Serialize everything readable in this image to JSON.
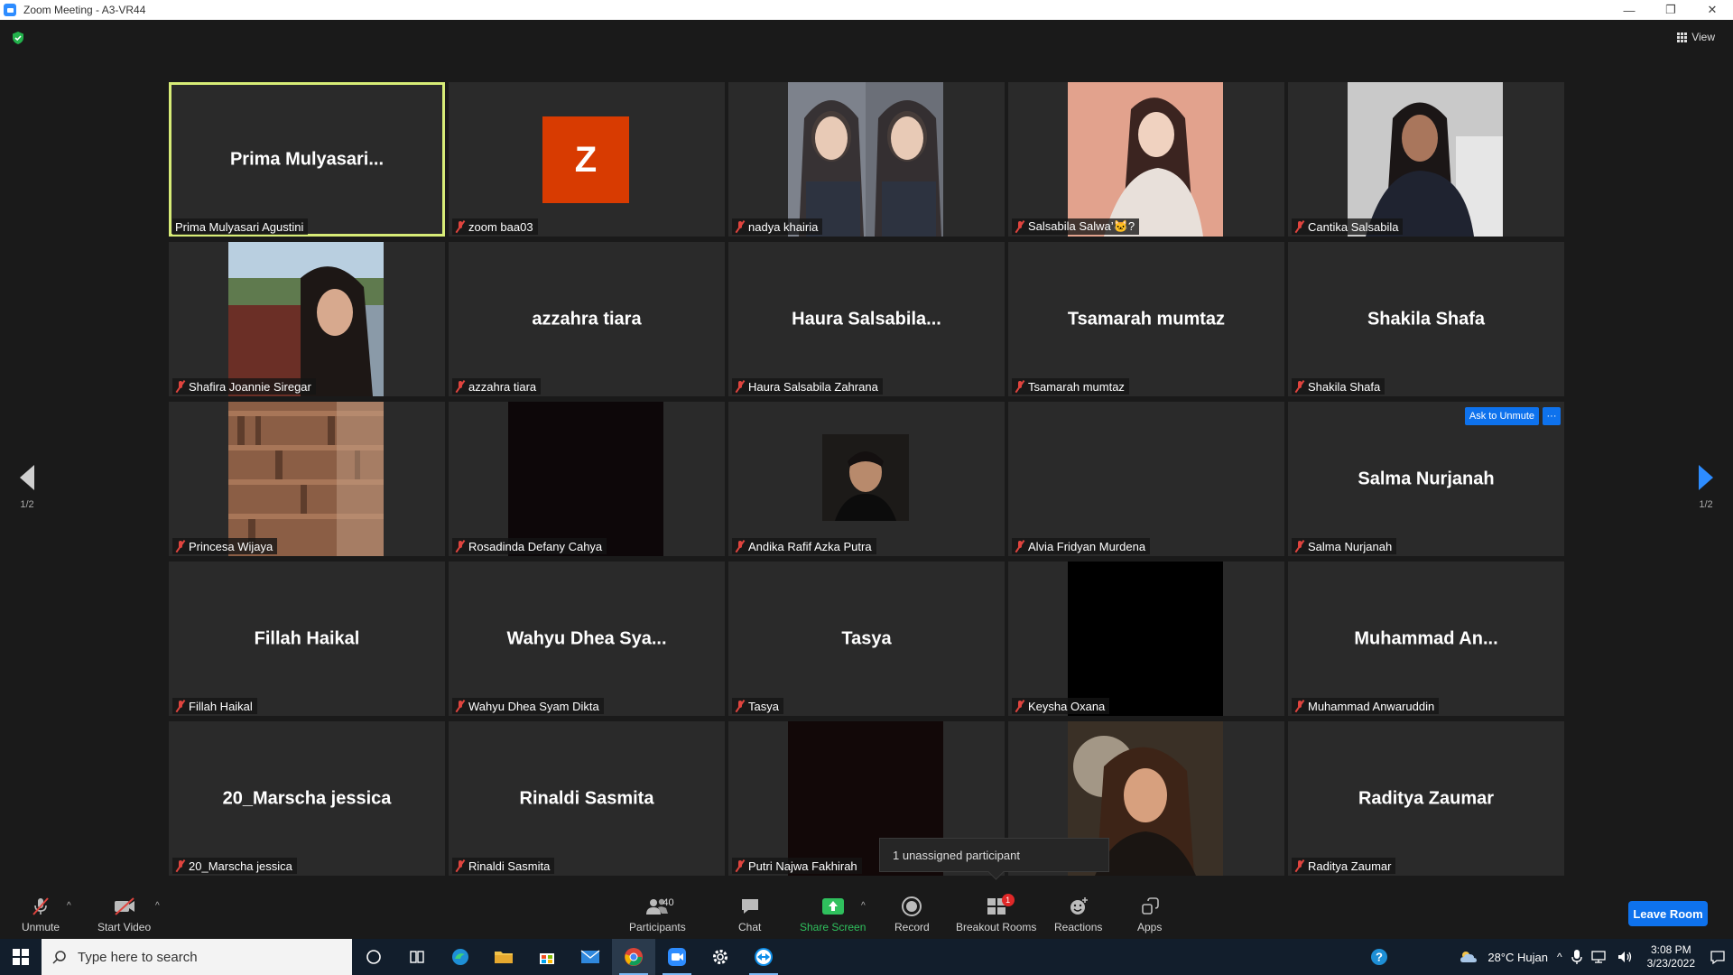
{
  "window": {
    "title": "Zoom Meeting - A3-VR44",
    "minimize": "—",
    "restore": "❐",
    "close": "✕"
  },
  "view_button": "View",
  "pager": {
    "left": "1/2",
    "right": "1/2"
  },
  "tiles": [
    {
      "big": "Prima  Mulyasari...",
      "label": "Prima Mulyasari Agustini",
      "muted": false,
      "active": true
    },
    {
      "big": "",
      "label": "zoom baa03",
      "muted": true,
      "avatar_letter": "Z"
    },
    {
      "big": "",
      "label": "nadya khairia",
      "muted": true
    },
    {
      "big": "",
      "label": "Salsabila Salwa’🐱?",
      "muted": true
    },
    {
      "big": "",
      "label": "Cantika Salsabila",
      "muted": true
    },
    {
      "big": "",
      "label": "Shafira Joannie Siregar",
      "muted": true
    },
    {
      "big": "azzahra tiara",
      "label": "azzahra tiara",
      "muted": true
    },
    {
      "big": "Haura  Salsabila...",
      "label": "Haura Salsabila Zahrana",
      "muted": true
    },
    {
      "big": "Tsamarah mumtaz",
      "label": "Tsamarah mumtaz",
      "muted": true
    },
    {
      "big": "Shakila Shafa",
      "label": "Shakila Shafa",
      "muted": true
    },
    {
      "big": "",
      "label": "Princesa Wijaya",
      "muted": true
    },
    {
      "big": "",
      "label": "Rosadinda Defany Cahya",
      "muted": true
    },
    {
      "big": "",
      "label": "Andika Rafif Azka Putra",
      "muted": true
    },
    {
      "big": "",
      "label": "Alvia Fridyan Murdena",
      "muted": true
    },
    {
      "big": "Salma Nurjanah",
      "label": "Salma Nurjanah",
      "muted": true,
      "ask_unmute": "Ask to Unmute",
      "more": "···"
    },
    {
      "big": "Fillah Haikal",
      "label": "Fillah Haikal",
      "muted": true
    },
    {
      "big": "Wahyu  Dhea  Sya...",
      "label": "Wahyu Dhea Syam Dikta",
      "muted": true
    },
    {
      "big": "Tasya",
      "label": "Tasya",
      "muted": true
    },
    {
      "big": "",
      "label": "Keysha Oxana",
      "muted": true
    },
    {
      "big": "Muhammad  An...",
      "label": "Muhammad Anwaruddin",
      "muted": true
    },
    {
      "big": "20_Marscha jessica",
      "label": "20_Marscha jessica",
      "muted": true
    },
    {
      "big": "Rinaldi Sasmita",
      "label": "Rinaldi Sasmita",
      "muted": true
    },
    {
      "big": "",
      "label": "Putri Najwa Fakhirah",
      "muted": true
    },
    {
      "big": "",
      "label": "",
      "muted": false
    },
    {
      "big": "Raditya Zaumar",
      "label": "Raditya Zaumar",
      "muted": true
    }
  ],
  "tooltip": "1 unassigned participant",
  "toolbar": {
    "unmute": "Unmute",
    "start_video": "Start Video",
    "participants": "Participants",
    "participants_count": "40",
    "chat": "Chat",
    "share_screen": "Share Screen",
    "record": "Record",
    "breakout_rooms": "Breakout Rooms",
    "breakout_badge": "1",
    "reactions": "Reactions",
    "apps": "Apps",
    "leave": "Leave Room"
  },
  "taskbar": {
    "search_placeholder": "Type here to search",
    "weather": "28°C  Hujan",
    "time": "3:08 PM",
    "date": "3/23/2022"
  },
  "colors": {
    "active_speaker": "#d7ec77",
    "accent": "#0e72ed",
    "muted_red": "#e0443e",
    "share_green": "#2fc05d"
  }
}
